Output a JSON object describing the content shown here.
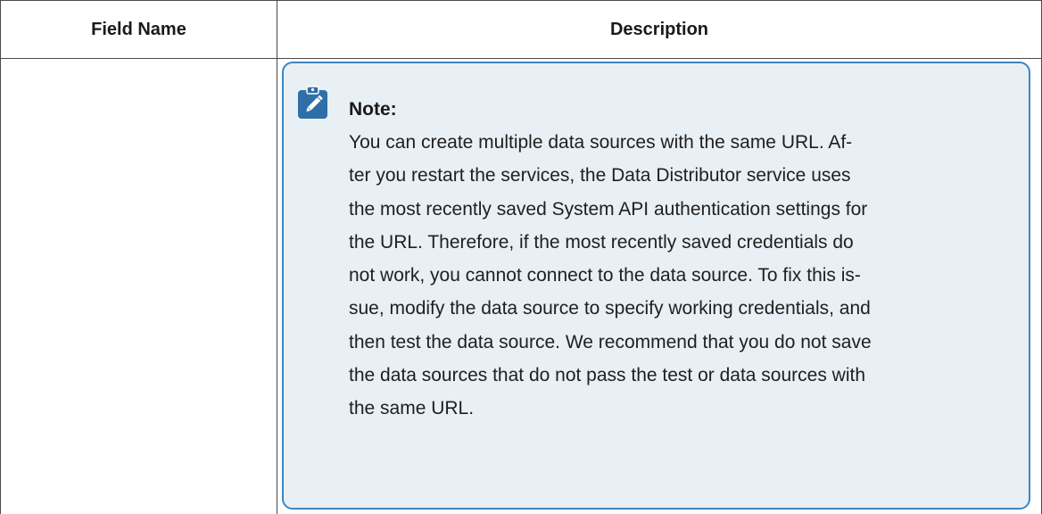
{
  "table": {
    "headers": {
      "field_name": "Field Name",
      "description": "Description"
    },
    "rows": [
      {
        "field_name": "",
        "note": {
          "icon": "note-pencil-icon",
          "title": "Note:",
          "lines": [
            "You can create multiple data sources with the same URL. Af-",
            "ter you restart the services, the Data Distributor service uses",
            "the most recently saved System API authentication settings for",
            "the URL. Therefore, if the most recently saved credentials do",
            "not work, you cannot connect to the data source. To fix this is-",
            "sue, modify the data source to specify working credentials, and",
            "then test the data source. We recommend that you do not save",
            "the data sources that do not pass the test or data sources with",
            "the same URL."
          ]
        }
      }
    ]
  },
  "colors": {
    "note_background": "#e8eff5",
    "note_border": "#3f85bf",
    "icon_background": "#2e6fa8"
  }
}
